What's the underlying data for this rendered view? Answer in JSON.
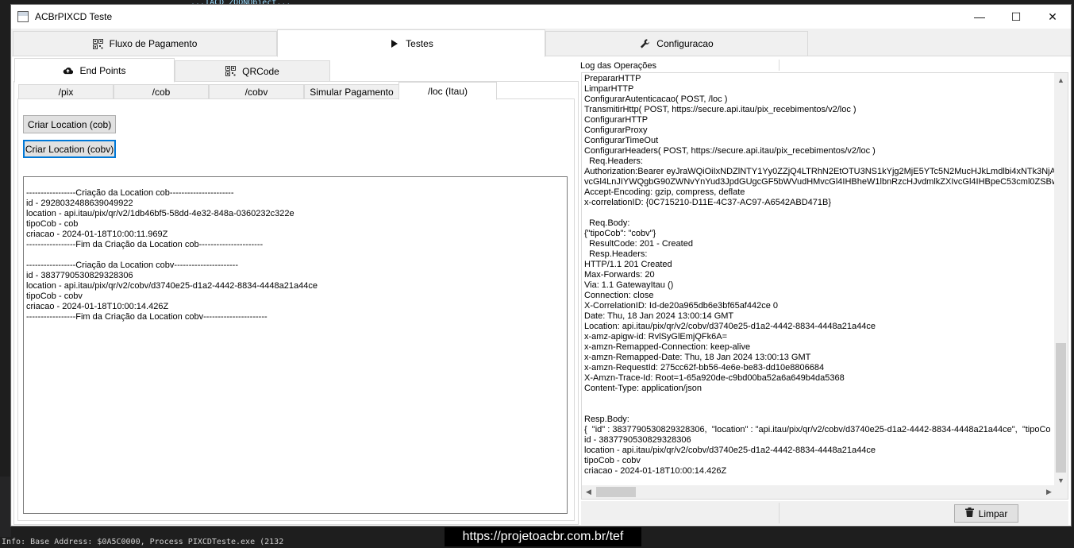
{
  "window": {
    "title": "ACBrPIXCD Teste",
    "controls": {
      "minimize": "—",
      "maximize": "☐",
      "close": "✕"
    }
  },
  "main_tabs": [
    {
      "label": "Fluxo de Pagamento",
      "icon": "qr-icon"
    },
    {
      "label": "Testes",
      "icon": "play-icon"
    },
    {
      "label": "Configuracao",
      "icon": "wrench-icon"
    }
  ],
  "left": {
    "tabs": [
      {
        "label": "End Points",
        "icon": "cloud-upload-icon"
      },
      {
        "label": "QRCode",
        "icon": "qr-icon"
      }
    ],
    "sub_tabs": [
      "/pix",
      "/cob",
      "/cobv",
      "Simular Pagamento",
      "/loc (Itau)"
    ],
    "buttons": {
      "criar_cob": "Criar Location (cob)",
      "criar_cobv": "Criar Location (cobv)"
    },
    "memo_lines": [
      "-----------------Criação da Location cob----------------------",
      "id - 2928032488639049922",
      "location - api.itau/pix/qr/v2/1db46bf5-58dd-4e32-848a-0360232c322e",
      "tipoCob - cob",
      "criacao - 2024-01-18T10:00:11.969Z",
      "-----------------Fim da Criação da Location cob----------------------",
      "",
      "-----------------Criação da Location cobv----------------------",
      "id - 3837790530829328306",
      "location - api.itau/pix/qr/v2/cobv/d3740e25-d1a2-4442-8834-4448a21a44ce",
      "tipoCob - cobv",
      "criacao - 2024-01-18T10:00:14.426Z",
      "-----------------Fim da Criação da Location cobv----------------------"
    ]
  },
  "log": {
    "title": "Log das Operações",
    "lines": [
      "PrepararHTTP",
      "LimparHTTP",
      "ConfigurarAutenticacao( POST, /loc )",
      "TransmitirHttp( POST, https://secure.api.itau/pix_recebimentos/v2/loc )",
      "ConfigurarHTTP",
      "ConfigurarProxy",
      "ConfigurarTimeOut",
      "ConfigurarHeaders( POST, https://secure.api.itau/pix_recebimentos/v2/loc )",
      "  Req.Headers:",
      "Authorization:Bearer eyJraWQiOiIxNDZlNTY1Yy0ZZjQ4LTRhN2EtOTU3NS1kYjg2MjE5YTc5N2MucHJkLmdlbi4xNTk3NjAwM",
      "vcGl4LnJIYWQgbG90ZWNvYnYud3JpdGUgcGF5bWVudHMvcGl4IHBheW1lbnRzcHJvdmlkZXIvcGl4IHBpeC53cml0ZSBwY",
      "Accept-Encoding: gzip, compress, deflate",
      "x-correlationID: {0C715210-D11E-4C37-AC97-A6542ABD471B}",
      "",
      "  Req.Body:",
      "{\"tipoCob\": \"cobv\"}",
      "  ResultCode: 201 - Created",
      "  Resp.Headers:",
      "HTTP/1.1 201 Created",
      "Max-Forwards: 20",
      "Via: 1.1 GatewayItau ()",
      "Connection: close",
      "X-CorrelationID: Id-de20a965db6e3bf65af442ce 0",
      "Date: Thu, 18 Jan 2024 13:00:14 GMT",
      "Location: api.itau/pix/qr/v2/cobv/d3740e25-d1a2-4442-8834-4448a21a44ce",
      "x-amz-apigw-id: RvlSyGlEmjQFk6A=",
      "x-amzn-Remapped-Connection: keep-alive",
      "x-amzn-Remapped-Date: Thu, 18 Jan 2024 13:00:13 GMT",
      "x-amzn-RequestId: 275cc62f-bb56-4e6e-be83-dd10e8806684",
      "X-Amzn-Trace-Id: Root=1-65a920de-c9bd00ba52a6a649b4da5368",
      "Content-Type: application/json",
      "",
      "",
      "Resp.Body:",
      "{  \"id\" : 3837790530829328306,  \"location\" : \"api.itau/pix/qr/v2/cobv/d3740e25-d1a2-4442-8834-4448a21a44ce\",  \"tipoCo",
      "id - 3837790530829328306",
      "location - api.itau/pix/qr/v2/cobv/d3740e25-d1a2-4442-8834-4448a21a44ce",
      "tipoCob - cobv",
      "criacao - 2024-01-18T10:00:14.426Z"
    ],
    "limpar_label": "Limpar"
  },
  "overlay": {
    "url": "https://projetoacbr.com.br/tef"
  },
  "background": {
    "code_snippet": "...TACD ZOONObject...",
    "output_line": "Info: Base Address: $0A5C0000, Process PIXCDTeste.exe (2132"
  }
}
